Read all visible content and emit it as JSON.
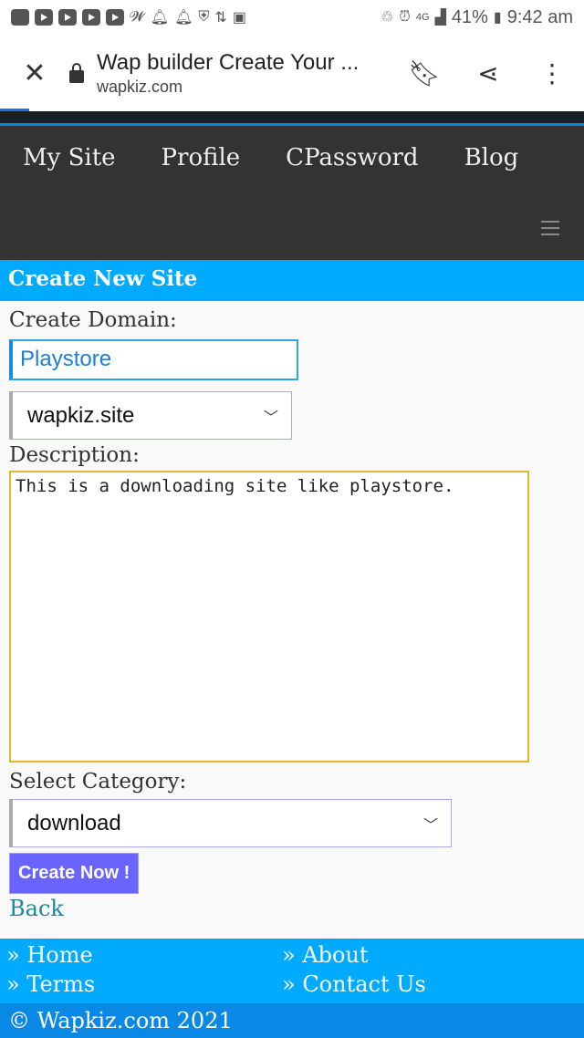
{
  "status_bar": {
    "battery": "41%",
    "time": "9:42 am",
    "network": "4G"
  },
  "browser": {
    "title": "Wap builder Create Your ...",
    "url": "wapkiz.com"
  },
  "nav": {
    "items": [
      "My Site",
      "Profile",
      "CPassword",
      "Blog"
    ]
  },
  "header": {
    "title": "Create New Site"
  },
  "form": {
    "domain_label": "Create Domain:",
    "domain_value": "Playstore",
    "domain_suffix": "wapkiz.site",
    "description_label": "Description:",
    "description_value": "This is a downloading site like playstore.",
    "category_label": "Select Category:",
    "category_value": "download",
    "submit_label": "Create Now !",
    "back_label": "Back"
  },
  "footer": {
    "links": [
      "» Home",
      "» About",
      "» Terms",
      "» Contact Us"
    ],
    "copyright": "© Wapkiz.com 2021"
  }
}
